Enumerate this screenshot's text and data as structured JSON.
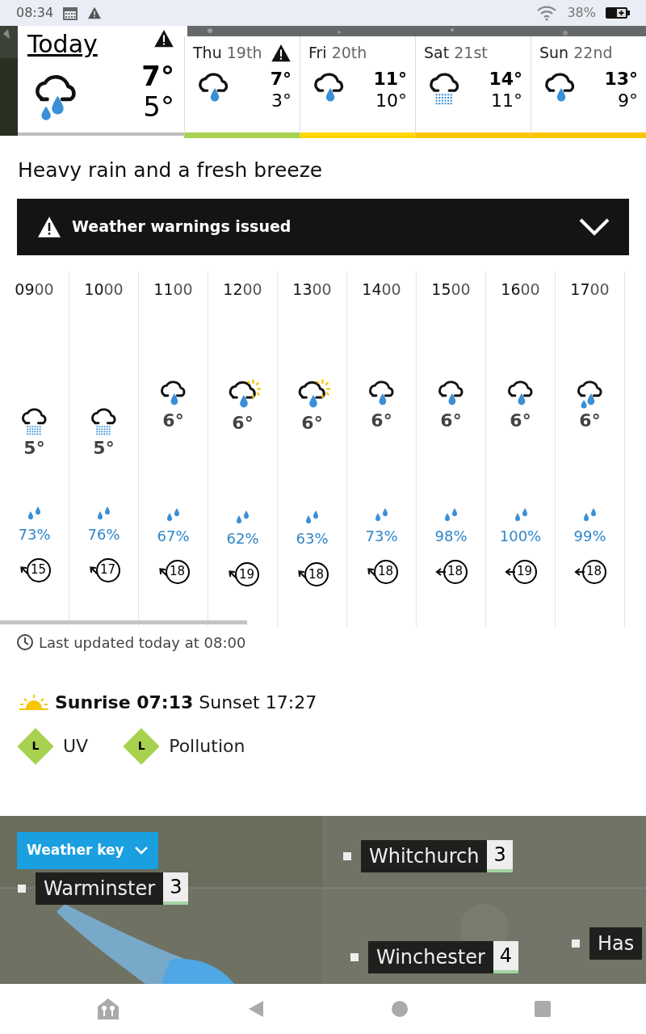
{
  "status_bar": {
    "time": "08:34",
    "battery": "38%"
  },
  "days": [
    {
      "day": "Today",
      "selected": true,
      "warning": true,
      "kind": "heavy-rain",
      "high": "7°",
      "low": "5°",
      "color": "#bdbdbd"
    },
    {
      "day": "Thu",
      "date": "19th",
      "selected": false,
      "warning": true,
      "kind": "light-rain",
      "high": "7°",
      "low": "3°",
      "color": "#a8d14f"
    },
    {
      "day": "Fri",
      "date": "20th",
      "selected": false,
      "warning": false,
      "kind": "light-rain",
      "high": "11°",
      "low": "10°",
      "color": "#ffd700"
    },
    {
      "day": "Sat",
      "date": "21st",
      "selected": false,
      "warning": false,
      "kind": "drizzle",
      "high": "14°",
      "low": "11°",
      "color": "#fbc400"
    },
    {
      "day": "Sun",
      "date": "22nd",
      "selected": false,
      "warning": false,
      "kind": "light-rain",
      "high": "13°",
      "low": "9°",
      "color": "#fbc400"
    }
  ],
  "summary": "Heavy rain and a fresh breeze",
  "warning_banner": {
    "label": "Weather warnings issued",
    "expanded": false
  },
  "hours": [
    {
      "hour": "09",
      "minutes": "00",
      "kind": "drizzle",
      "temp": "5°",
      "rain": "73%",
      "wind": {
        "speed": "15",
        "kind": "northwest"
      }
    },
    {
      "hour": "10",
      "minutes": "00",
      "kind": "drizzle",
      "temp": "5°",
      "rain": "76%",
      "wind": {
        "speed": "17",
        "kind": "northwest"
      }
    },
    {
      "hour": "11",
      "minutes": "00",
      "kind": "light-rain",
      "temp": "6°",
      "rain": "67%",
      "wind": {
        "speed": "18",
        "kind": "northwest"
      }
    },
    {
      "hour": "12",
      "minutes": "00",
      "kind": "sunny-rain",
      "temp": "6°",
      "rain": "62%",
      "wind": {
        "speed": "19",
        "kind": "northwest"
      }
    },
    {
      "hour": "13",
      "minutes": "00",
      "kind": "sunny-rain",
      "temp": "6°",
      "rain": "63%",
      "wind": {
        "speed": "18",
        "kind": "northwest"
      }
    },
    {
      "hour": "14",
      "minutes": "00",
      "kind": "light-rain",
      "temp": "6°",
      "rain": "73%",
      "wind": {
        "speed": "18",
        "kind": "northwest"
      }
    },
    {
      "hour": "15",
      "minutes": "00",
      "kind": "light-rain",
      "temp": "6°",
      "rain": "98%",
      "wind": {
        "speed": "18",
        "kind": "west"
      }
    },
    {
      "hour": "16",
      "minutes": "00",
      "kind": "light-rain",
      "temp": "6°",
      "rain": "100%",
      "wind": {
        "speed": "19",
        "kind": "west"
      }
    },
    {
      "hour": "17",
      "minutes": "00",
      "kind": "heavy-rain",
      "temp": "6°",
      "rain": "99%",
      "wind": {
        "speed": "18",
        "kind": "west"
      }
    }
  ],
  "last_updated": "Last updated today at 08:00",
  "sun": "**Sunrise 07:13** Sunset 17:27",
  "indices": [
    {
      "badge": "L",
      "label": "UV",
      "color": "#a8d14f"
    },
    {
      "badge": "L",
      "label": "Pollution",
      "color": "#a8d14f"
    }
  ],
  "map": {
    "key_button": "Weather key",
    "places": [
      {
        "name": "Warminster",
        "temp": "3"
      },
      {
        "name": "Whitchurch",
        "temp": "3"
      },
      {
        "name": "Winchester",
        "temp": "4"
      },
      {
        "name": "Has"
      }
    ]
  }
}
